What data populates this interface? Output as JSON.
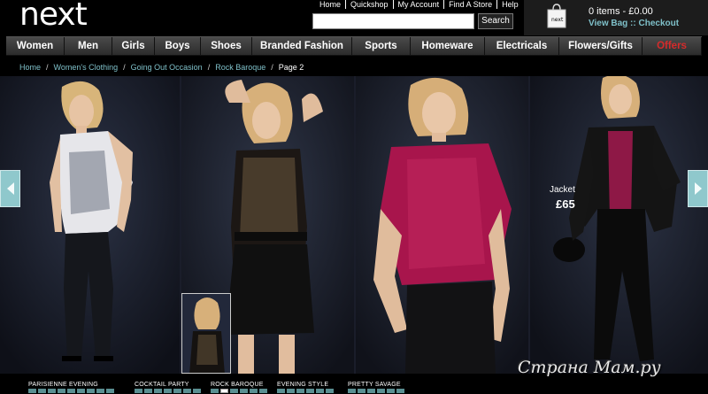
{
  "header": {
    "logo_text": "next",
    "top_links": [
      "Home",
      "Quickshop",
      "My Account",
      "Find A Store",
      "Help"
    ],
    "search_placeholder": "",
    "search_label": "Search",
    "bag_items": "0 items - £0.00",
    "bag_links": "View Bag :: Checkout"
  },
  "nav": {
    "items": [
      "Women",
      "Men",
      "Girls",
      "Boys",
      "Shoes",
      "Branded Fashion",
      "Sports",
      "Homeware",
      "Electricals",
      "Flowers/Gifts",
      "Offers"
    ]
  },
  "breadcrumb": {
    "items": [
      "Home",
      "Women's Clothing",
      "Going Out Occasion",
      "Rock Baroque"
    ],
    "current": "Page 2"
  },
  "gallery": {
    "price_label": "Jacket",
    "price_value": "£65"
  },
  "bottom": {
    "categories": [
      "PARISIENNE EVENING",
      "COCKTAIL PARTY",
      "ROCK BAROQUE",
      "EVENING STYLE",
      "PRETTY SAVAGE"
    ]
  },
  "watermark": "Страна Мам.ру",
  "colors": {
    "accent": "#7fc0c9",
    "offers": "#d52b2b",
    "arrow": "#8fc8cc"
  }
}
